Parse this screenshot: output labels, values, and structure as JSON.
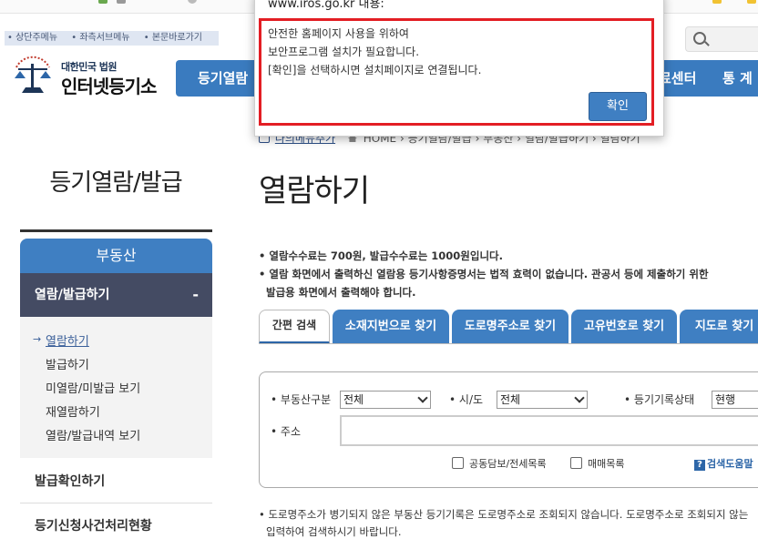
{
  "skip_links": [
    "상단주메뉴",
    "좌측서브메뉴",
    "본문바로가기"
  ],
  "logo": {
    "line1": "대한민국 법원",
    "line2": "인터넷등기소"
  },
  "gnb": {
    "items": [
      "등기열람",
      "료센터",
      "통 계"
    ]
  },
  "sidebar": {
    "title": "등기열람/발급",
    "category": "부동산",
    "section": "열람/발급하기",
    "section_toggle": "-",
    "items": [
      {
        "label": "열람하기",
        "active": true,
        "arrow": "→"
      },
      {
        "label": "발급하기"
      },
      {
        "label": "미열람/미발급 보기"
      },
      {
        "label": "재열람하기"
      },
      {
        "label": "열람/발급내역 보기"
      }
    ],
    "links": [
      "발급확인하기",
      "등기신청사건처리현황"
    ]
  },
  "breadcrumb": {
    "mymenu": "나의메뉴추가",
    "path": "HOME › 등기열람/발급 › 부동산 › 열람/발급하기 › 열람하기"
  },
  "page_title": "열람하기",
  "notices": [
    "열람수수료는 700원, 발급수수료는 1000원입니다.",
    "열람 화면에서 출력하신 열람용 등기사항증명서는 법적 효력이 없습니다. 관공서 등에 제출하기 위한",
    "발급용 화면에서 출력해야 합니다."
  ],
  "tabs": [
    "간편 검색",
    "소재지번으로 찾기",
    "도로명주소로 찾기",
    "고유번호로 찾기",
    "지도로 찾기"
  ],
  "form": {
    "property_type_label": "부동산구분",
    "property_type_value": "전체",
    "sido_label": "시/도",
    "sido_value": "전체",
    "record_status_label": "등기기록상태",
    "record_status_value": "현행",
    "address_label": "주소",
    "checkbox1": "공동담보/전세목록",
    "checkbox2": "매매목록",
    "help": "검색도움말",
    "help_icon": "?"
  },
  "bottom_note": [
    "도로명주소가 병기되지 않은 부동산 등기기록은 도로명주소로 조회되지 않습니다. 도로명주소로 조회되지 않는",
    "입력하여 검색하시기 바랍니다."
  ],
  "dialog": {
    "host": "www.iros.go.kr 내용:",
    "lines": [
      "안전한 홈페이지 사용을 위하여",
      "보안프로그램 설치가 필요합니다.",
      "[확인]을 선택하시면 설치페이지로 연결됩니다."
    ],
    "ok_label": "확인"
  },
  "colors": {
    "primary_blue": "#3f7fc2",
    "nav_dark": "#444b63",
    "alert_red": "#e31e24"
  }
}
